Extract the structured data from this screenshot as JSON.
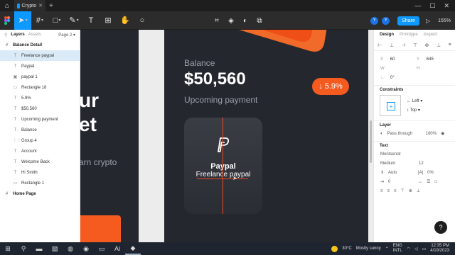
{
  "browser": {
    "tab_title": "Crypto"
  },
  "toolbar": {
    "avatars": [
      "Y",
      "Y"
    ],
    "share_label": "Share",
    "zoom": "155%"
  },
  "layers_panel": {
    "tabs": [
      "Layers",
      "Assets"
    ],
    "page": "Page 2",
    "items": [
      {
        "label": "Balance Detail",
        "type": "frame"
      },
      {
        "label": "Freelance paypal",
        "type": "text",
        "selected": true
      },
      {
        "label": "Paypal",
        "type": "text"
      },
      {
        "label": "paypal 1",
        "type": "image"
      },
      {
        "label": "Rectangle 18",
        "type": "rect"
      },
      {
        "label": "5.9%",
        "type": "text"
      },
      {
        "label": "$50,560",
        "type": "text"
      },
      {
        "label": "Upcoming payment",
        "type": "text"
      },
      {
        "label": "Balance",
        "type": "text"
      },
      {
        "label": "Group 4",
        "type": "group"
      },
      {
        "label": "Account",
        "type": "text"
      },
      {
        "label": "Welcome Back",
        "type": "text"
      },
      {
        "label": "Hi Smith",
        "type": "text"
      },
      {
        "label": "Rectangle 1",
        "type": "rect"
      },
      {
        "label": "Home Page",
        "type": "frame"
      }
    ]
  },
  "canvas": {
    "left_frame": {
      "line1": "ur",
      "line2": "et",
      "sub": "arn crypto"
    },
    "balance_label": "Balance",
    "balance_value": "$50,560",
    "upcoming_label": "Upcoming payment",
    "change_badge": "5.9%",
    "card": {
      "title": "Paypal",
      "subtitle": "Freelance paypal"
    },
    "accent_color": "#f55a1e"
  },
  "design_panel": {
    "tabs": [
      "Design",
      "Prototype",
      "Inspect"
    ],
    "x": "60",
    "y": "645",
    "w": "W",
    "h": "H",
    "rotation": "0°",
    "constraints_title": "Constraints",
    "constraint_h": "Left",
    "constraint_v": "Top",
    "layer_title": "Layer",
    "blend": "Pass through",
    "opacity": "100%",
    "text_title": "Text",
    "font_family": "Montserrat",
    "font_weight": "Medium",
    "font_size": "12",
    "line_height": "Auto",
    "letter_spacing": "0%",
    "paragraph": "0"
  },
  "taskbar": {
    "temperature": "30°C",
    "weather": "Mostly sunny",
    "lang1": "ENG",
    "lang2": "INTL",
    "time": "12:35 PM",
    "date": "4/19/2023"
  }
}
